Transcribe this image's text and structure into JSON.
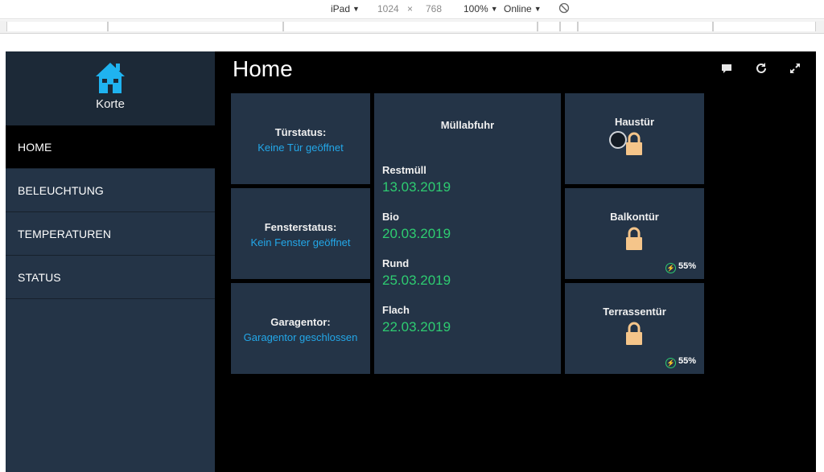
{
  "devtools": {
    "device": "iPad",
    "width": "1024",
    "times": "×",
    "height": "768",
    "zoom": "100%",
    "network": "Online"
  },
  "sidebar": {
    "brand": "Korte",
    "items": [
      {
        "label": "HOME",
        "active": true
      },
      {
        "label": "BELEUCHTUNG",
        "active": false
      },
      {
        "label": "TEMPERATUREN",
        "active": false
      },
      {
        "label": "STATUS",
        "active": false
      }
    ]
  },
  "header": {
    "title": "Home",
    "icons": [
      "comment-icon",
      "refresh-icon",
      "fullscreen-icon"
    ]
  },
  "status_tiles": [
    {
      "label": "Türstatus:",
      "value": "Keine Tür geöffnet"
    },
    {
      "label": "Fensterstatus:",
      "value": "Kein Fenster geöffnet"
    },
    {
      "label": "Garagentor:",
      "value": "Garagentor geschlossen"
    }
  ],
  "muellabfuhr": {
    "title": "Müllabfuhr",
    "entries": [
      {
        "label": "Restmüll",
        "date": "13.03.2019"
      },
      {
        "label": "Bio",
        "date": "20.03.2019"
      },
      {
        "label": "Rund",
        "date": "25.03.2019"
      },
      {
        "label": "Flach",
        "date": "22.03.2019"
      }
    ]
  },
  "locks": [
    {
      "label": "Haustür",
      "battery": ""
    },
    {
      "label": "Balkontür",
      "battery": "55%"
    },
    {
      "label": "Terrassentür",
      "battery": "55%"
    }
  ],
  "colors": {
    "panel": "#243447",
    "link": "#23a7e8",
    "date": "#2ecc71",
    "lock": "#f5c58a",
    "background": "#000000"
  }
}
